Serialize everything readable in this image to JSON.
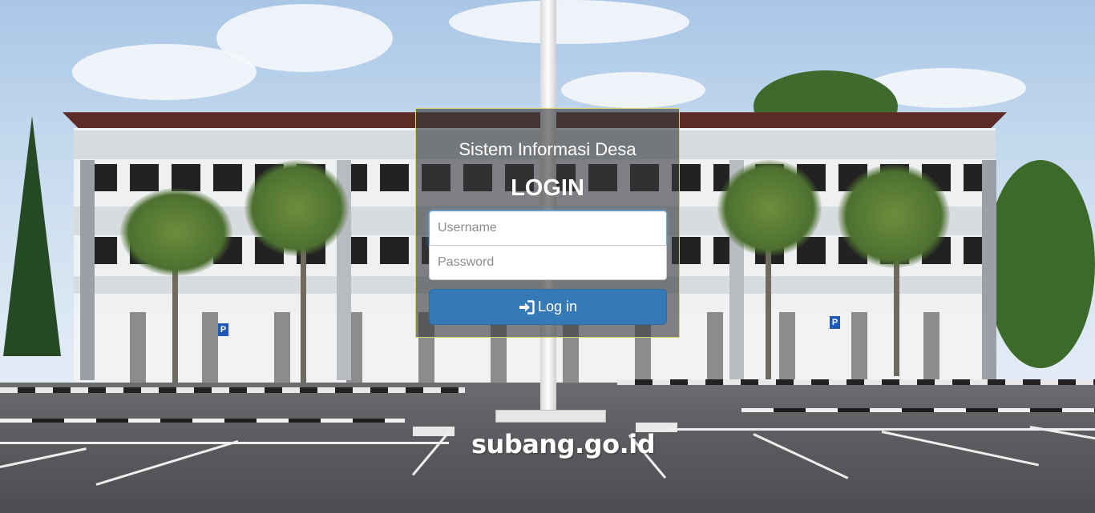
{
  "app_title": "Sistem Informasi Desa",
  "login_heading": "LOGIN",
  "form": {
    "username_placeholder": "Username",
    "password_placeholder": "Password",
    "submit_label": "Log in",
    "submit_icon": "sign-in-icon"
  },
  "background": {
    "watermark": "subang.go.id",
    "parking_sign": "P"
  },
  "colors": {
    "button": "#337ab7",
    "panel_border": "#d9d36a",
    "focus_border": "#66afe9"
  }
}
